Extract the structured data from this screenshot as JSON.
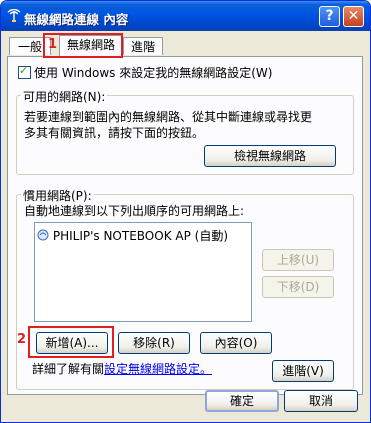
{
  "window": {
    "title": "無線網路連線 內容",
    "help_glyph": "?",
    "close_glyph": "✕"
  },
  "tabs": [
    {
      "label": "一般"
    },
    {
      "label": "無線網路"
    },
    {
      "label": "進階"
    }
  ],
  "annotations": {
    "one": "1",
    "two": "2",
    "color": "#e02020"
  },
  "use_windows": {
    "label": "使用 Windows 來設定我的無線網路設定(W)",
    "checked": true
  },
  "available": {
    "group_label": "可用的網路(N):",
    "desc_line1": "若要連線到範圍內的無線網路、從其中斷連線或尋找更",
    "desc_line2": "多其有關資訊，請按下面的按鈕。",
    "view_button": "檢視無線網路"
  },
  "preferred": {
    "group_label": "慣用網路(P):",
    "desc": "自動地連線到以下列出順序的可用網路上:",
    "networks": [
      {
        "name": "PHILIP's NOTEBOOK AP (自動)",
        "icon": "wireless-network-icon"
      }
    ],
    "move_up": "上移(U)",
    "move_down": "下移(D)"
  },
  "actions": {
    "add": "新增(A)...",
    "remove": "移除(R)",
    "properties": "內容(O)"
  },
  "learn_more": {
    "prefix": "詳細了解有關",
    "link": "設定無線網路設定。"
  },
  "advanced_button": "進階(V)",
  "footer": {
    "ok": "確定",
    "cancel": "取消"
  }
}
